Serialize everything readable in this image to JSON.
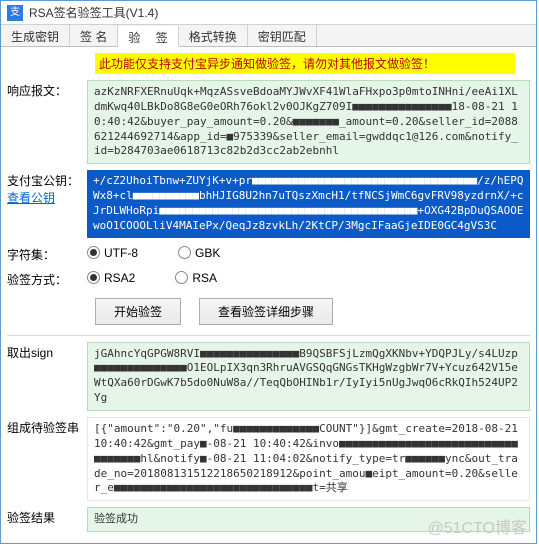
{
  "window": {
    "title": "RSA签名验签工具(V1.4)"
  },
  "tabs": {
    "items": [
      {
        "label": "生成密钥"
      },
      {
        "label": "签 名"
      },
      {
        "label": "验 签"
      },
      {
        "label": "格式转换"
      },
      {
        "label": "密钥匹配"
      }
    ],
    "active_index": 2
  },
  "notice": "此功能仅支持支付宝异步通知做验签，请勿对其他报文做验签！",
  "labels": {
    "response": "响应报文：",
    "alipayKey": "支付宝公钥：",
    "viewKey": "查看公钥",
    "charset": "字符集：",
    "verifyMethod": "验签方式：",
    "extractSign": "取出sign",
    "pendingString": "组成待验签串",
    "result": "验签结果"
  },
  "response_text": "azKzNRFXERnuUqk+MqzASsveBdoaMYJWvXF41WlaFHxpo3p0mtoINHni/eeAi1XLdmKwq40LBkDo8G8eG0eORh76okl2v0OJKgZ709I■■■■■■■■■■■■■■■18-08-21 10:40:42&buyer_pay_amount=0.20&■■■■■■■_amount=0.20&seller_id=2088621244692714&app_id=■975339&seller_email=gwddqc1@126.com&notify_id=b284703ae0618713c82b2d3cc2ab2ebnhl",
  "alipayKey_text": "+/cZ2UhoiTbnw+ZUYjK+v+pr■■■■■■■■■■■■■■■■■■■■■■■■■■■■■■■■■■/z/hEPQWx8+cl■■■■■■■■■■bhHJIG8U2hn7uTQszXmcH1/tfNCSjWmC6gvFRV98yzdrnX/+cJrDLWHoRpi■■■■■■■■■■■■■■■■■■■■■■■■■■■■■■■■■■■■■■■+OXG42BpDuQSAOOEwoO1COOOLliV4MAIePx/QeqJz8zvkLh/2KtCP/3MgcIFaaGjeIDE0GC4gVS3C",
  "charset": {
    "options": [
      {
        "label": "UTF-8",
        "checked": true
      },
      {
        "label": "GBK",
        "checked": false
      }
    ]
  },
  "verify_method": {
    "options": [
      {
        "label": "RSA2",
        "checked": true
      },
      {
        "label": "RSA",
        "checked": false
      }
    ]
  },
  "buttons": {
    "start": "开始验签",
    "detail": "查看验签详细步骤"
  },
  "extract_sign_text": "jGAhncYqGPGW8RVI■■■■■■■■■■■■■■■B9QSBFSjLzmQgXKNbv+YDQPJLy/s4LUzp■■■■■■■■■■■■■■O1EOLpIX3qn3RhruAVGSQqGNGsTKHgWzgbWr7V+Ycuz642V15eWtQXa60rDGwK7b5do0NuW8a//TeqQbOHINb1r/IyIyi5nUgJwqO6cRkQIh524UP2Yg",
  "pending_string_text": "[{\"amount\":\"0.20\",\"fu■■■■■■■■■■■■■COUNT\"}]&gmt_create=2018-08-21 10:40:42&gmt_pay■-08-21 10:40:42&invo■■■■■■■■■■■■■■■■■■■■■■■■■■■■■■■■■■hl&notify■-08-21 11:04:02&notify_type=tr■■■■■■ync&out_trade_no=201808131512218650218912&point_amou■eipt_amount=0.20&seller_e■■■■■■■■■■■■■■■■■■■■■■■■■■■■■■t=共享",
  "result_text": "验签成功",
  "watermark": "@51CTO博客"
}
